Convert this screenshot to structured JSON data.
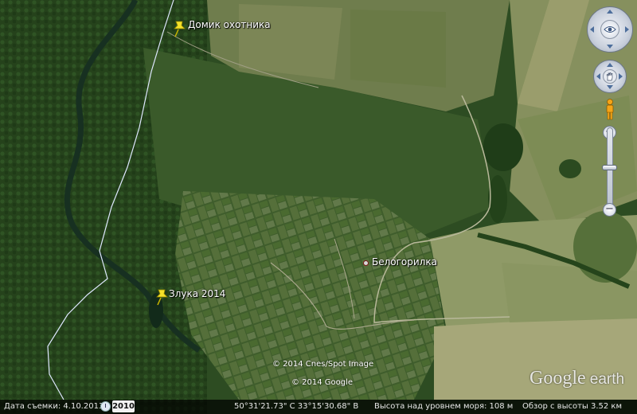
{
  "markers": {
    "pin1": {
      "label": "Домик охотника"
    },
    "pin2": {
      "label": "Злука 2014"
    }
  },
  "places": {
    "town": {
      "label": "Белогорилка"
    }
  },
  "imagery_credits": {
    "line1": "© 2014 Cnes/Spot Image",
    "line2": "© 2014 Google"
  },
  "logo": {
    "google": "Google",
    "earth": "earth"
  },
  "status_bar": {
    "imagery_date": "Дата съемки: 4.10.2013",
    "historical_year": "2010",
    "coordinates": "50°31'21.73\" С  33°15'30.68\" В",
    "elevation": "Высота над уровнем моря:  108 м",
    "eye_altitude": "Обзор с высоты   3.52 км"
  },
  "controls": {
    "look_icon": "eye-icon",
    "move_icon": "hand-icon",
    "street_view_icon": "pegman-icon",
    "zoom_in": "+",
    "zoom_out": "−"
  },
  "colors": {
    "pin_yellow": "#f5e12a",
    "place_dot_border": "#7a1a1a",
    "boundary_line": "#dfe8ff"
  }
}
